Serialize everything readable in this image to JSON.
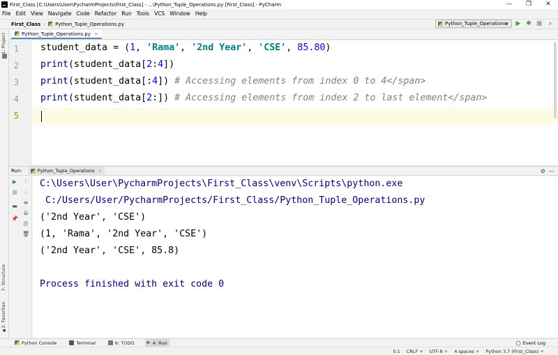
{
  "window": {
    "title": "First_Class [C:\\Users\\User\\PycharmProjects\\First_Class] - ...\\Python_Tuple_Operations.py [First_Class] - PyCharm",
    "minimize": "—",
    "restore": "❐",
    "close": "✕"
  },
  "menu": {
    "items": [
      "File",
      "Edit",
      "View",
      "Navigate",
      "Code",
      "Refactor",
      "Run",
      "Tools",
      "VCS",
      "Window",
      "Help"
    ]
  },
  "navbar": {
    "project": "First_Class",
    "file": "Python_Tuple_Operations.py",
    "run_config": "Python_Tuple_Operations"
  },
  "left_strip": {
    "project_tab": "1: Project",
    "structure_tab": "7: Structure",
    "favorites_tab": "2: Favorites"
  },
  "editor": {
    "tab_label": "Python_Tuple_Operations.py",
    "line_numbers": [
      "1",
      "2",
      "3",
      "4",
      "5"
    ],
    "lines": [
      {
        "tokens": [
          {
            "t": "student_data = (",
            "c": ""
          },
          {
            "t": "1",
            "c": "k-num"
          },
          {
            "t": ", ",
            "c": ""
          },
          {
            "t": "'Rama'",
            "c": "k-str"
          },
          {
            "t": ", ",
            "c": ""
          },
          {
            "t": "'2nd Year'",
            "c": "k-str"
          },
          {
            "t": ", ",
            "c": ""
          },
          {
            "t": "'CSE'",
            "c": "k-str"
          },
          {
            "t": ", ",
            "c": ""
          },
          {
            "t": "85.80",
            "c": "k-num"
          },
          {
            "t": ")",
            "c": ""
          }
        ]
      },
      {
        "tokens": [
          {
            "t": "print",
            "c": "k-builtin"
          },
          {
            "t": "(student_data[",
            "c": ""
          },
          {
            "t": "2",
            "c": "k-num"
          },
          {
            "t": ":",
            "c": ""
          },
          {
            "t": "4",
            "c": "k-num"
          },
          {
            "t": "])",
            "c": ""
          }
        ]
      },
      {
        "tokens": [
          {
            "t": "print",
            "c": "k-builtin"
          },
          {
            "t": "(student_data[:",
            "c": ""
          },
          {
            "t": "4",
            "c": "k-num"
          },
          {
            "t": "]) ",
            "c": ""
          },
          {
            "t": "# Accessing elements from index 0 to 4</span>",
            "c": "k-comment"
          }
        ]
      },
      {
        "tokens": [
          {
            "t": "print",
            "c": "k-builtin"
          },
          {
            "t": "(student_data[",
            "c": ""
          },
          {
            "t": "2",
            "c": "k-num"
          },
          {
            "t": ":]) ",
            "c": ""
          },
          {
            "t": "# Accessing elements from index 2 to last element</span>",
            "c": "k-comment"
          }
        ]
      },
      {
        "tokens": []
      }
    ]
  },
  "run": {
    "label": "Run:",
    "tab_label": "Python_Tuple_Operations",
    "output": [
      {
        "text": "C:\\Users\\User\\PycharmProjects\\First_Class\\venv\\Scripts\\python.exe",
        "kind": "sys"
      },
      {
        "text": " C:/Users/User/PycharmProjects/First_Class/Python_Tuple_Operations.py",
        "kind": "sys"
      },
      {
        "text": "('2nd Year', 'CSE')",
        "kind": "norm"
      },
      {
        "text": "(1, 'Rama', '2nd Year', 'CSE')",
        "kind": "norm"
      },
      {
        "text": "('2nd Year', 'CSE', 85.8)",
        "kind": "norm"
      },
      {
        "text": "",
        "kind": "norm"
      },
      {
        "text": "Process finished with exit code 0",
        "kind": "sys"
      }
    ]
  },
  "bottom_tabs": {
    "python_console": "Python Console",
    "terminal": "Terminal",
    "todo": "6: TODO",
    "run": "4: Run",
    "event_log": "Event Log"
  },
  "status": {
    "position": "5:1",
    "line_sep": "CRLF ÷",
    "encoding": "UTF-8 ÷",
    "indent": "4 spaces ÷",
    "interpreter": "Python 3.7 (First_Class) ÷"
  },
  "colors": {
    "accent": "#4a88c7",
    "run_green": "#3c9a3c",
    "current_line": "#fffae3"
  }
}
